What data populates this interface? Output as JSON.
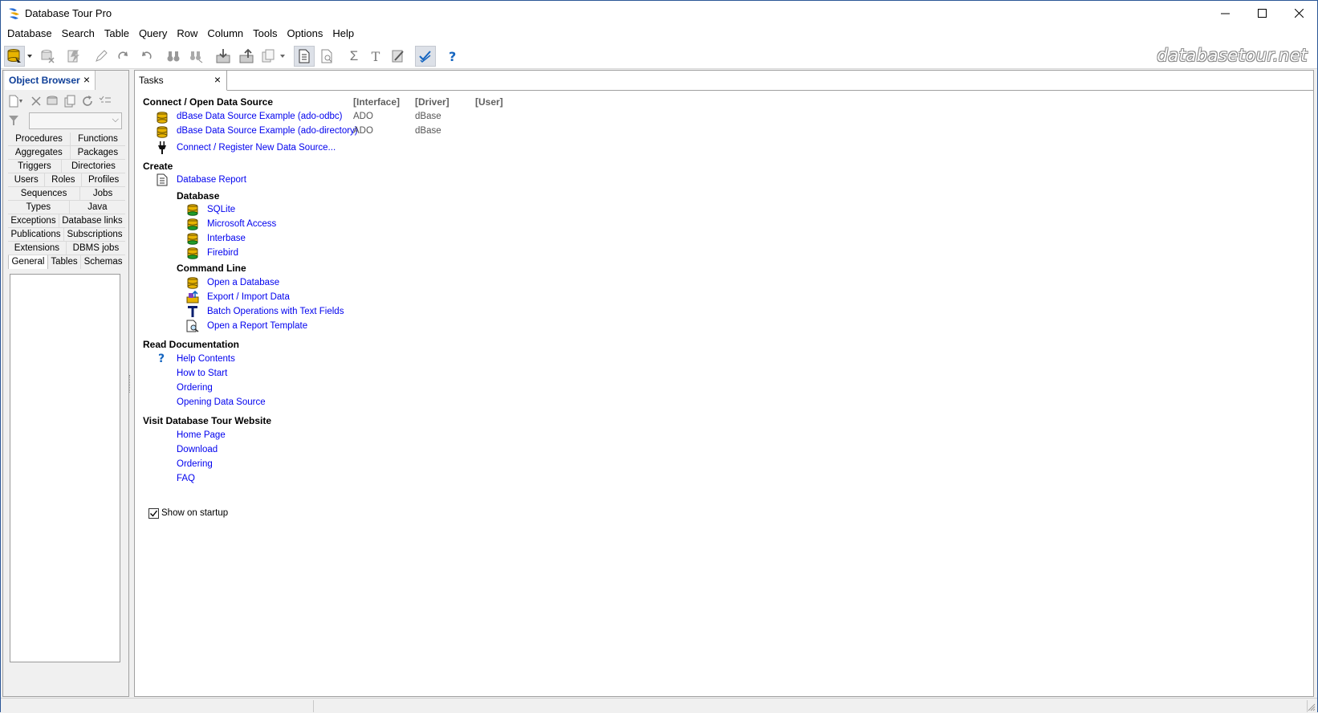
{
  "window": {
    "title": "Database Tour Pro"
  },
  "menu": [
    "Database",
    "Search",
    "Table",
    "Query",
    "Row",
    "Column",
    "Tools",
    "Options",
    "Help"
  ],
  "watermark": "databasetour.net",
  "object_browser": {
    "tab_label": "Object Browser",
    "close": "×",
    "filter_value": "",
    "grid": [
      [
        "Procedures",
        "Functions"
      ],
      [
        "Aggregates",
        "Packages"
      ],
      [
        "Triggers",
        "Directories"
      ],
      [
        "Users",
        "Roles",
        "Profiles"
      ],
      [
        "Sequences",
        "Jobs"
      ],
      [
        "Types",
        "Java"
      ],
      [
        "Exceptions",
        "Database links"
      ],
      [
        "Publications",
        "Subscriptions"
      ],
      [
        "Extensions",
        "DBMS jobs"
      ],
      [
        "General",
        "Tables",
        "Schemas"
      ]
    ],
    "selected_tab": "General"
  },
  "tasks": {
    "tab_label": "Tasks",
    "close": "×",
    "connect": {
      "heading": "Connect / Open Data Source",
      "col_interface": "[Interface]",
      "col_driver": "[Driver]",
      "col_user": "[User]",
      "rows": [
        {
          "name": "dBase Data Source Example (ado-odbc)",
          "interface": "ADO",
          "driver": "dBase"
        },
        {
          "name": "dBase Data Source Example (ado-directory)",
          "interface": "ADO",
          "driver": "dBase"
        }
      ],
      "new_source": "Connect / Register New Data Source..."
    },
    "create": {
      "heading": "Create",
      "report": "Database Report",
      "db_heading": "Database",
      "databases": [
        "SQLite",
        "Microsoft Access",
        "Interbase",
        "Firebird"
      ],
      "cl_heading": "Command Line",
      "command_line": [
        "Open a Database",
        "Export / Import Data",
        "Batch Operations with Text Fields",
        "Open a Report Template"
      ]
    },
    "docs": {
      "heading": "Read Documentation",
      "items": [
        "Help Contents",
        "How to Start",
        "Ordering",
        "Opening Data Source"
      ]
    },
    "website": {
      "heading": "Visit Database Tour Website",
      "items": [
        "Home Page",
        "Download",
        "Ordering",
        "FAQ"
      ]
    },
    "show_on_startup": {
      "label": "Show on startup",
      "checked": true
    }
  },
  "colors": {
    "link": "#0000ee",
    "accent": "#0f3f98",
    "db_icon": "#e8b400",
    "db_icon_green": "#1f9d2a"
  }
}
